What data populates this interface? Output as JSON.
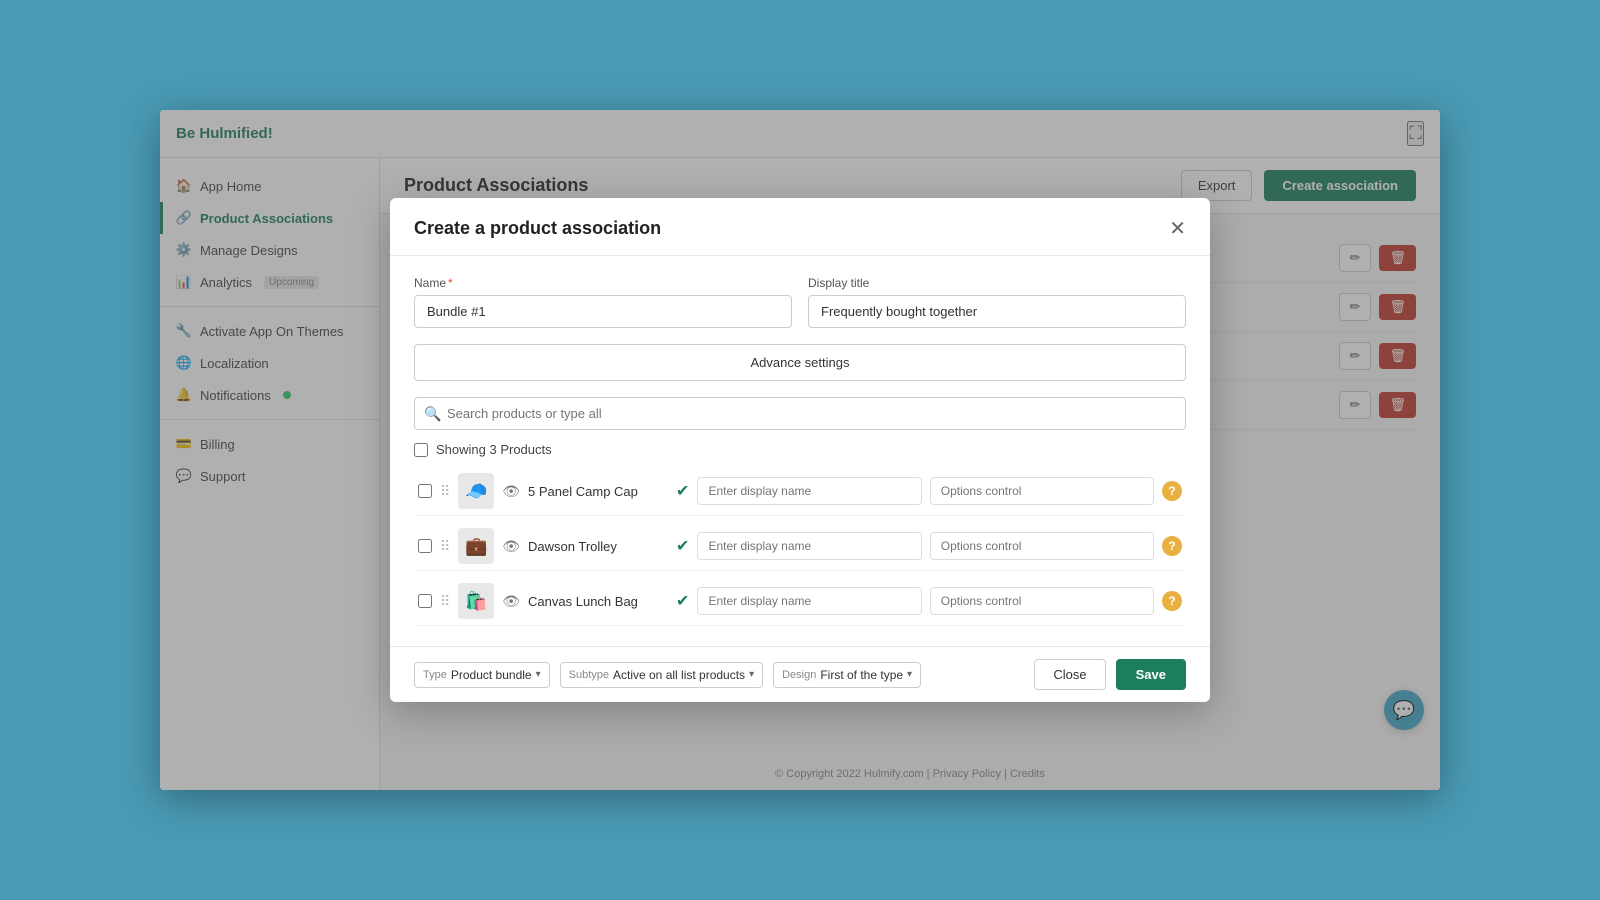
{
  "app": {
    "brand_be": "Be",
    "brand_name": "Hulmified!",
    "title": "Product Associations",
    "footer": "© Copyright 2022 Hulmify.com | Privacy Policy | Credits"
  },
  "sidebar": {
    "items": [
      {
        "id": "app-home",
        "label": "App Home",
        "icon": "🏠",
        "active": false
      },
      {
        "id": "product-associations",
        "label": "Product Associations",
        "icon": "🔗",
        "active": true
      },
      {
        "id": "manage-designs",
        "label": "Manage Designs",
        "icon": "⚙️",
        "active": false
      },
      {
        "id": "analytics",
        "label": "Analytics",
        "icon": "📊",
        "active": false,
        "badge": "Upcoming"
      },
      {
        "id": "activate-app",
        "label": "Activate App On Themes",
        "icon": "🔧",
        "active": false
      },
      {
        "id": "localization",
        "label": "Localization",
        "icon": "🌐",
        "active": false
      },
      {
        "id": "notifications",
        "label": "Notifications",
        "icon": "🔔",
        "active": false,
        "dot": true
      },
      {
        "id": "billing",
        "label": "Billing",
        "icon": "💳",
        "active": false
      },
      {
        "id": "support",
        "label": "Support",
        "icon": "💬",
        "active": false
      }
    ]
  },
  "topbar": {
    "export_label": "Export",
    "create_label": "Create association"
  },
  "modal": {
    "title": "Create a product association",
    "name_label": "Name",
    "name_required": "*",
    "name_value": "Bundle #1",
    "display_title_label": "Display title",
    "display_title_value": "Frequently bought together",
    "advance_settings_label": "Advance settings",
    "search_placeholder": "Search products or type all",
    "showing_label": "Showing 3 Products",
    "products": [
      {
        "id": "p1",
        "name": "5 Panel Camp Cap",
        "thumb": "🧢",
        "display_name_placeholder": "Enter display name",
        "options_placeholder": "Options control",
        "verified": true
      },
      {
        "id": "p2",
        "name": "Dawson Trolley",
        "thumb": "💼",
        "display_name_placeholder": "Enter display name",
        "options_placeholder": "Options control",
        "verified": true
      },
      {
        "id": "p3",
        "name": "Canvas Lunch Bag",
        "thumb": "🛍️",
        "display_name_placeholder": "Enter display name",
        "options_placeholder": "Options control",
        "verified": true
      }
    ],
    "footer": {
      "type_label": "Type",
      "type_value": "Product bundle",
      "subtype_label": "Subtype",
      "subtype_value": "Active on all list products",
      "design_label": "Design",
      "design_value": "First of the type",
      "close_label": "Close",
      "save_label": "Save"
    }
  },
  "table_rows": [
    {
      "id": "r1"
    },
    {
      "id": "r2"
    },
    {
      "id": "r3"
    },
    {
      "id": "r4"
    }
  ],
  "icons": {
    "close": "✕",
    "search": "🔍",
    "drag": "⠿",
    "eye": "👁",
    "check": "✓",
    "help": "?",
    "pencil": "✏",
    "trash": "🗑",
    "expand": "⛶",
    "chat": "💬",
    "chevron_down": "▾"
  }
}
